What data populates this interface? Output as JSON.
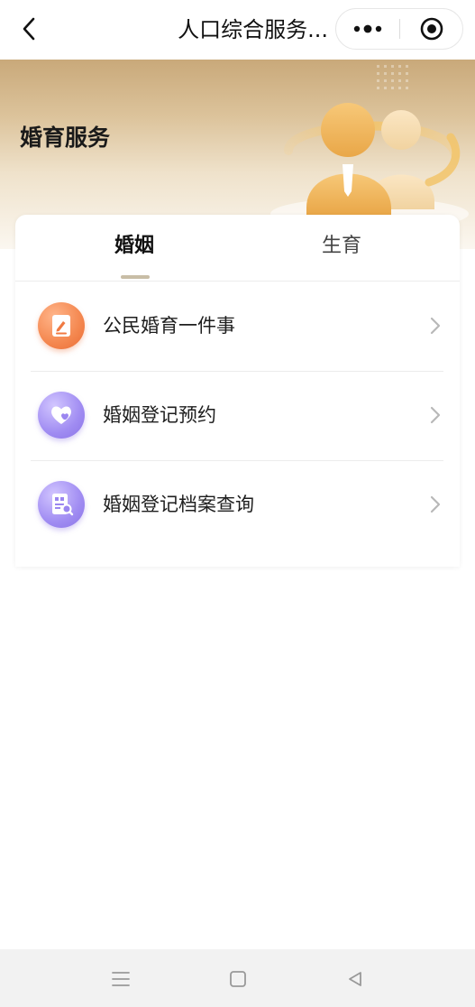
{
  "navbar": {
    "title": "人口综合服务..."
  },
  "banner": {
    "title": "婚育服务"
  },
  "tabs": [
    {
      "label": "婚姻",
      "active": true
    },
    {
      "label": "生育",
      "active": false
    }
  ],
  "items": [
    {
      "label": "公民婚育一件事",
      "icon": "document-edit-icon"
    },
    {
      "label": "婚姻登记预约",
      "icon": "heart-icon"
    },
    {
      "label": "婚姻登记档案查询",
      "icon": "archive-search-icon"
    }
  ],
  "system_nav": [
    "menu-icon",
    "home-icon",
    "back-triangle-icon"
  ],
  "colors": {
    "orange_icon": "#f4874f",
    "purple_icon": "#a08cf2",
    "banner_gold": "#dcc39b",
    "tab_indicator": "#c8bda6"
  }
}
